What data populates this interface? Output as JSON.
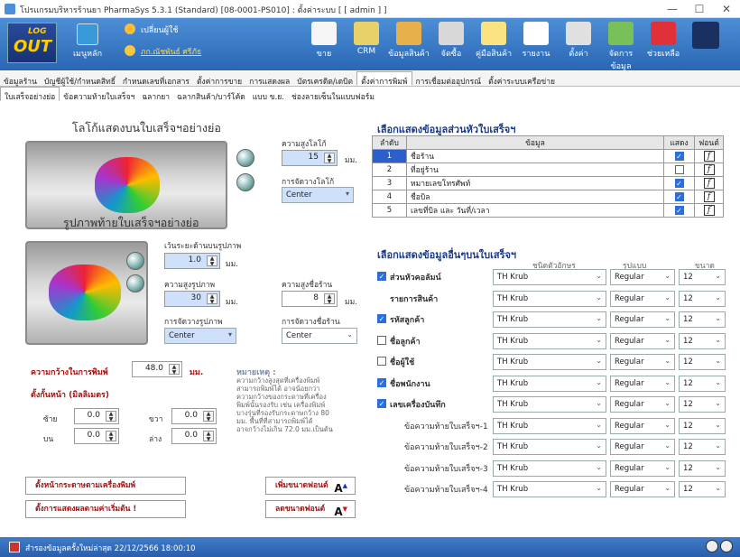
{
  "window": {
    "title": "โปรแกรมบริหารร้านยา PharmaSys 5.3.1 (Standard) [08-0001-PS010] : ตั้งค่าระบบ  [ [ admin ] ]",
    "min": "—",
    "max": "☐",
    "close": "✕"
  },
  "toolbar": {
    "logout_top": "LOG",
    "logout_bottom": "OUT",
    "main_menu": "เมนูหลัก",
    "change_user": "เปลี่ยนผู้ใช้",
    "user_name": "ภก.ณัชพันธ์ ศรีภัธ",
    "buttons": [
      {
        "label": "ขาย",
        "icon": "sale-icon",
        "color": "#f5f5f5"
      },
      {
        "label": "CRM",
        "icon": "crm-icon",
        "color": "#e9d16a"
      },
      {
        "label": "ข้อมูลสินค้า",
        "icon": "product-icon",
        "color": "#e8b04a"
      },
      {
        "label": "จัดซื้อ",
        "icon": "purchase-icon",
        "color": "#d8d8d8"
      },
      {
        "label": "คู่มือสินค้า",
        "icon": "manual-icon",
        "color": "#fae380"
      },
      {
        "label": "รายงาน",
        "icon": "report-icon",
        "color": "#ffffff"
      },
      {
        "label": "ตั้งค่า",
        "icon": "settings-icon",
        "color": "#e0e0e0"
      },
      {
        "label": "จัดการข้อมูล",
        "icon": "data-icon",
        "color": "#7ac05a"
      },
      {
        "label": "ช่วยเหลือ",
        "icon": "help-icon",
        "color": "#e0303a"
      },
      {
        "label": "",
        "icon": "exit-icon",
        "color": "#1a3060"
      }
    ]
  },
  "tabs_main": [
    {
      "label": "ข้อมูลร้าน",
      "active": false
    },
    {
      "label": "บัญชีผู้ใช้/กำหนดสิทธิ์",
      "active": false
    },
    {
      "label": "กำหนดเลขที่เอกสาร",
      "active": false
    },
    {
      "label": "ตั้งค่าการขาย",
      "active": false
    },
    {
      "label": "การแสดงผล",
      "active": false
    },
    {
      "label": "บัตรเครดิต/เดบิต",
      "active": false
    },
    {
      "label": "ตั้งค่าการพิมพ์",
      "active": true
    },
    {
      "label": "การเชื่อมต่ออุปกรณ์",
      "active": false
    },
    {
      "label": "ตั้งค่าระบบเครือข่าย",
      "active": false
    }
  ],
  "tabs_sub": [
    {
      "label": "ใบเสร็จอย่างย่อ",
      "active": true
    },
    {
      "label": "ข้อความท้ายใบเสร็จฯ",
      "active": false
    },
    {
      "label": "ฉลากยา",
      "active": false
    },
    {
      "label": "ฉลากสินค้า/บาร์โค้ด",
      "active": false
    },
    {
      "label": "แบบ ข.ย.",
      "active": false
    },
    {
      "label": "ช่องลายเซ็นในแบบฟอร์ม",
      "active": false
    }
  ],
  "logo_section": {
    "title": "โลโก้แสดงบนใบเสร็จฯอย่างย่อ",
    "height_label": "ความสูงโลโก้",
    "height_value": "15",
    "unit": "มม.",
    "align_label": "การจัดวางโลโก้",
    "align_value": "Center"
  },
  "footer_image_section": {
    "title": "รูปภาพท้ายใบเสร็จฯอย่างย่อ",
    "top_space_label": "เว้นระยะด้านบนรูปภาพ",
    "top_space_value": "1.0",
    "img_height_label": "ความสูงรูปภาพ",
    "img_height_value": "30",
    "unit": "มม.",
    "shop_height_label": "ความสูงชื่อร้าน",
    "shop_height_value": "8",
    "img_align_label": "การจัดวางรูปภาพ",
    "img_align_value": "Center",
    "shop_align_label": "การจัดวางชื่อร้าน",
    "shop_align_value": "Center"
  },
  "print_width": {
    "label": "ความกว้างในการพิมพ์",
    "value": "48.0",
    "unit": "มม."
  },
  "margins": {
    "title": "ตั้งกั้นหน้า (มิลลิเมตร)",
    "left_label": "ซ้าย",
    "left_value": "0.0",
    "right_label": "ขวา",
    "right_value": "0.0",
    "top_label": "บน",
    "top_value": "0.0",
    "bottom_label": "ล่าง",
    "bottom_value": "0.0"
  },
  "note": {
    "title": "หมายเหตุ :",
    "lines": [
      "ความกว้างสูงสุดที่เครื่องพิมพ์",
      "สามารถพิมพ์ได้ อาจน้อยกว่า",
      "ความกว้างของกระดาษที่เครื่อง",
      "พิมพ์นั้นรองรับ เช่น เครื่องพิมพ์",
      "บางรุ่นที่รองรับกระดาษกว้าง 80",
      "มม. พื้นที่ที่สามารถพิมพ์ได้",
      "อาจกว้างไม่เกิน 72.0 มม.เป็นต้น"
    ]
  },
  "buttons": {
    "page_setup": "ตั้งหน้ากระดาษตามเครื่องพิมพ์",
    "reset_defaults": "ตั้งการแสดงผลตามค่าเริ่มต้น !",
    "font_up": "เพิ่มขนาดฟอนต์",
    "font_down": "ลดขนาดฟอนต์"
  },
  "header_info": {
    "title": "เลือกแสดงข้อมูลส่วนหัวใบเสร็จฯ",
    "columns": [
      "ลำดับ",
      "ข้อมูล",
      "แสดง",
      "ฟอนต์"
    ],
    "rows": [
      {
        "no": "1",
        "name": "ชื่อร้าน",
        "show": true
      },
      {
        "no": "2",
        "name": "ที่อยู่ร้าน",
        "show": false
      },
      {
        "no": "3",
        "name": "หมายเลขโทรศัพท์",
        "show": true
      },
      {
        "no": "4",
        "name": "ชื่อบิล",
        "show": true
      },
      {
        "no": "5",
        "name": "เลขที่บิล และ วันที่/เวลา",
        "show": true
      }
    ],
    "fx": "f"
  },
  "other_info": {
    "title": "เลือกแสดงข้อมูลอื่นๆบนใบเสร็จฯ",
    "col_font": "ชนิดตัวอักษร",
    "col_style": "รูปแบบ",
    "col_size": "ขนาด",
    "rows": [
      {
        "label": "ส่วนหัวคอลัมน์",
        "checkbox": true,
        "checked": true,
        "font": "TH Krub",
        "style": "Regular",
        "size": "12"
      },
      {
        "label": "รายการสินค้า",
        "checkbox": false,
        "checked": false,
        "font": "TH Krub",
        "style": "Regular",
        "size": "12"
      },
      {
        "label": "รหัสลูกค้า",
        "checkbox": true,
        "checked": true,
        "font": "TH Krub",
        "style": "Regular",
        "size": "12"
      },
      {
        "label": "ชื่อลูกค้า",
        "checkbox": true,
        "checked": false,
        "font": "TH Krub",
        "style": "Regular",
        "size": "12"
      },
      {
        "label": "ชื่อผู้ใช้",
        "checkbox": true,
        "checked": false,
        "font": "TH Krub",
        "style": "Regular",
        "size": "12"
      },
      {
        "label": "ชื่อพนักงาน",
        "checkbox": true,
        "checked": true,
        "font": "TH Krub",
        "style": "Regular",
        "size": "12"
      },
      {
        "label": "เลขเครื่องบันทึก",
        "checkbox": true,
        "checked": true,
        "font": "TH Krub",
        "style": "Regular",
        "size": "12"
      },
      {
        "label": "ข้อความท้ายใบเสร็จฯ-1",
        "checkbox": false,
        "checked": false,
        "font": "TH Krub",
        "style": "Regular",
        "size": "12"
      },
      {
        "label": "ข้อความท้ายใบเสร็จฯ-2",
        "checkbox": false,
        "checked": false,
        "font": "TH Krub",
        "style": "Regular",
        "size": "12"
      },
      {
        "label": "ข้อความท้ายใบเสร็จฯ-3",
        "checkbox": false,
        "checked": false,
        "font": "TH Krub",
        "style": "Regular",
        "size": "12"
      },
      {
        "label": "ข้อความท้ายใบเสร็จฯ-4",
        "checkbox": false,
        "checked": false,
        "font": "TH Krub",
        "style": "Regular",
        "size": "12"
      }
    ]
  },
  "status": {
    "text": "สำรองข้อมูลครั้งใหม่ล่าสุด  22/12/2566 18:00:10"
  }
}
